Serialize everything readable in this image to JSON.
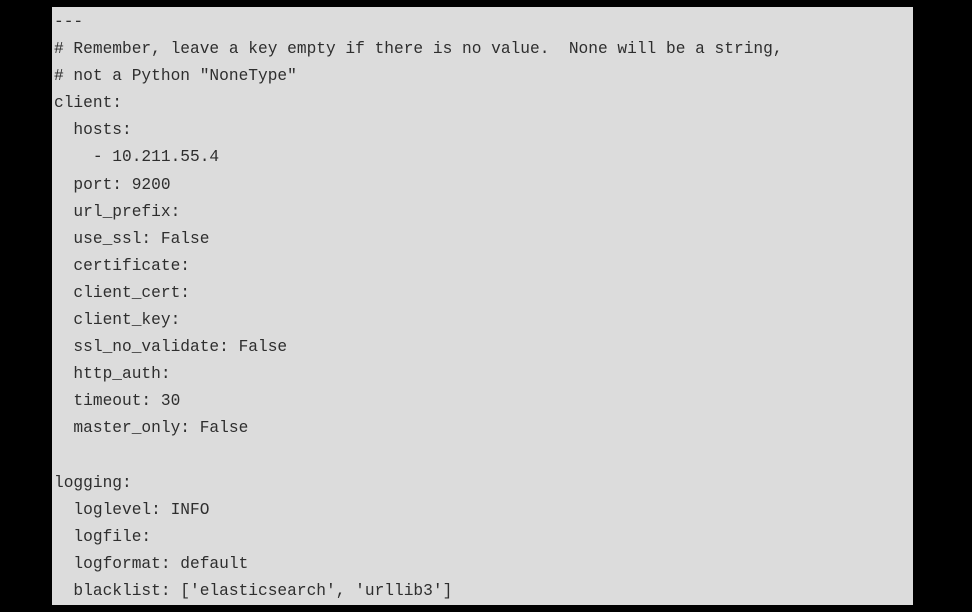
{
  "code": {
    "lines": [
      "---",
      "# Remember, leave a key empty if there is no value.  None will be a string,",
      "# not a Python \"NoneType\"",
      "client:",
      "  hosts:",
      "    - 10.211.55.4",
      "  port: 9200",
      "  url_prefix:",
      "  use_ssl: False",
      "  certificate:",
      "  client_cert:",
      "  client_key:",
      "  ssl_no_validate: False",
      "  http_auth:",
      "  timeout: 30",
      "  master_only: False",
      "",
      "logging:",
      "  loglevel: INFO",
      "  logfile:",
      "  logformat: default",
      "  blacklist: ['elasticsearch', 'urllib3']"
    ]
  }
}
